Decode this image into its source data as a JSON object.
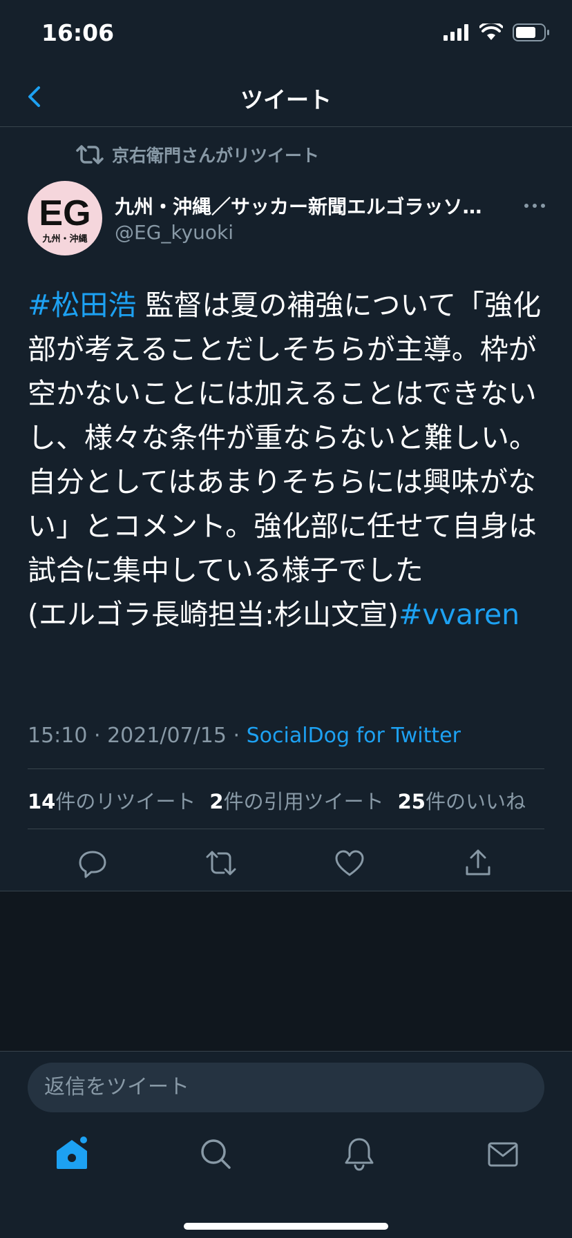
{
  "status_bar": {
    "time": "16:06"
  },
  "nav": {
    "title": "ツイート"
  },
  "tweet": {
    "retweeted_by": "京右衛門さんがリツイート",
    "author_name": "九州・沖縄／サッカー新聞エルゴラッソ…",
    "author_handle": "@EG_kyuoki",
    "avatar_text": "EG",
    "avatar_sub": "九州・沖縄",
    "text_hashtag1": "#松田浩",
    "text_body": " 監督は夏の補強について「強化部が考えることだしそちらが主導。枠が空かないことには加えることはできないし、様々な条件が重ならないと難しい。自分としてはあまりそちらには興味がない」とコメント。強化部に任せて自身は試合に集中している様子でした",
    "text_credit": "(エルゴラ長崎担当:杉山文宣)",
    "text_hashtag2": "#vvaren",
    "timestamp": "15:10 · 2021/07/15 · ",
    "source": "SocialDog for Twitter"
  },
  "stats": {
    "retweets_count": "14",
    "retweets_label": "件のリツイート",
    "quotes_count": "2",
    "quotes_label": "件の引用ツイート",
    "likes_count": "25",
    "likes_label": "件のいいね"
  },
  "reply": {
    "placeholder": "返信をツイート"
  },
  "colors": {
    "background": "#15202b",
    "accent": "#1da1f2",
    "secondary": "#8899a6",
    "divider": "#38444d"
  },
  "icons": [
    "back-chevron-icon",
    "retweet-icon",
    "more-icon",
    "reply-icon",
    "share-icon",
    "like-icon",
    "home-icon",
    "search-icon",
    "notifications-icon",
    "messages-icon"
  ]
}
